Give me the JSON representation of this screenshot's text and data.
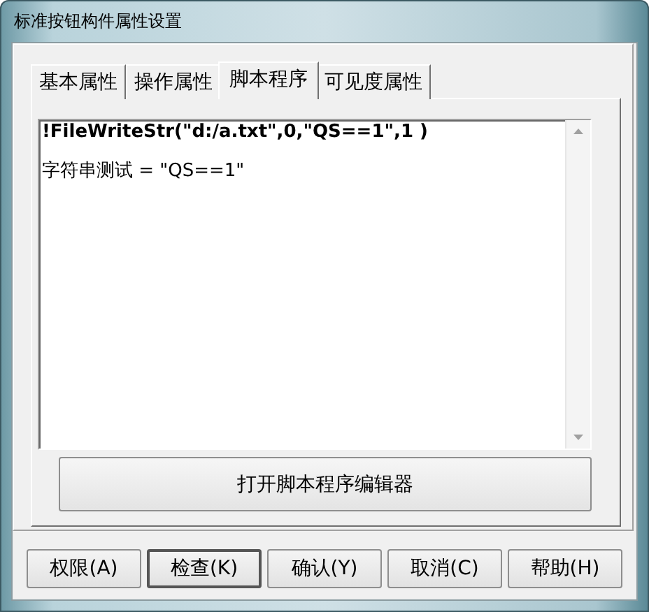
{
  "window": {
    "title": "标准按钮构件属性设置"
  },
  "tabs": [
    {
      "label": "基本属性",
      "selected": false
    },
    {
      "label": "操作属性",
      "selected": false
    },
    {
      "label": "脚本程序",
      "selected": true
    },
    {
      "label": "可见度属性",
      "selected": false
    }
  ],
  "script_editor": {
    "lines": [
      "!FileWriteStr(\"d:/a.txt\",0,\"QS==1\",1 )",
      "字符串测试 = \"QS==1\""
    ]
  },
  "editor_button": "打开脚本程序编辑器",
  "buttons": [
    {
      "label": "权限(A)",
      "default": false
    },
    {
      "label": "检查(K)",
      "default": true
    },
    {
      "label": "确认(Y)",
      "default": false
    },
    {
      "label": "取消(C)",
      "default": false
    },
    {
      "label": "帮助(H)",
      "default": false
    }
  ]
}
